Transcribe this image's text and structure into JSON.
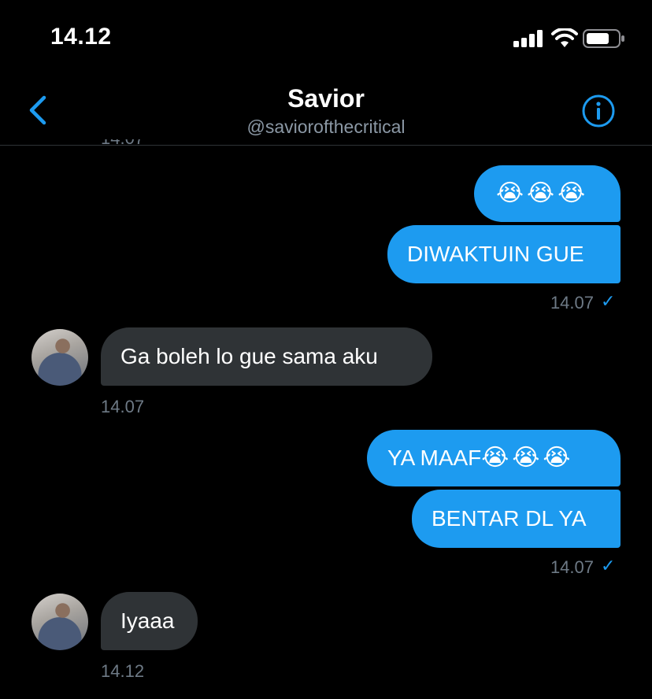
{
  "status_bar": {
    "time": "14.12"
  },
  "header": {
    "name": "Savior",
    "handle": "@saviorofthecritical"
  },
  "conversation": {
    "clipped_timestamp": "14.07",
    "messages": [
      {
        "from": "me",
        "text": "😭😭😭"
      },
      {
        "from": "me",
        "text": "DIWAKTUIN GUE"
      },
      {
        "from": "me_meta",
        "time": "14.07",
        "read": "✓"
      },
      {
        "from": "them",
        "text": "Ga boleh lo gue sama aku",
        "time": "14.07"
      },
      {
        "from": "me",
        "text": "YA MAAF",
        "emoji": "😭😭😭"
      },
      {
        "from": "me",
        "text": "BENTAR DL YA"
      },
      {
        "from": "me_meta",
        "time": "14.07",
        "read": "✓"
      },
      {
        "from": "them",
        "text": "Iyaaa",
        "time": "14.12"
      }
    ]
  },
  "colors": {
    "accent": "#1d9bf0",
    "incoming_bubble": "#2f3336",
    "muted": "#6e7a86",
    "background": "#000000"
  },
  "icons": {
    "back": "chevron-left-icon",
    "info": "info-icon",
    "signal": "cellular-signal-icon",
    "wifi": "wifi-icon",
    "battery": "battery-icon"
  }
}
